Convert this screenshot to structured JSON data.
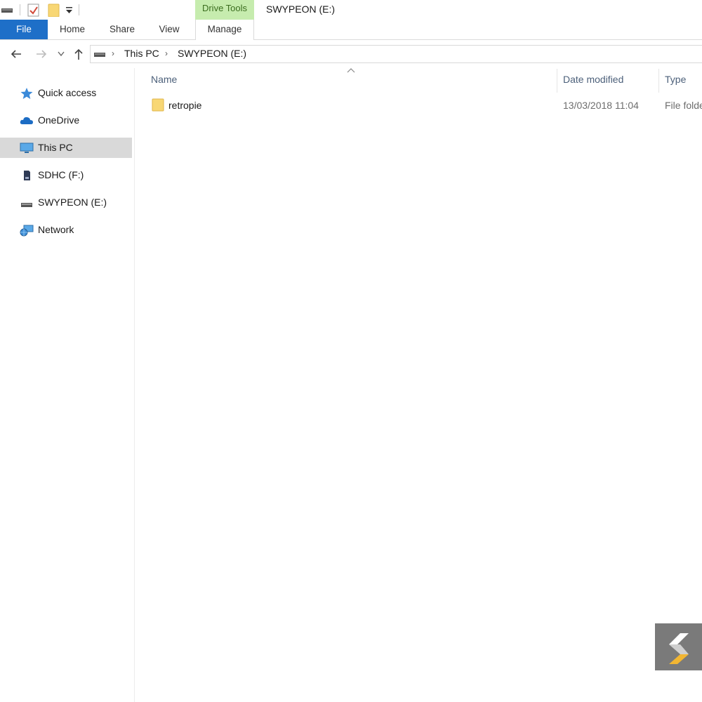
{
  "window": {
    "title": "SWYPEON (E:)"
  },
  "ribbon": {
    "context_group": "Drive Tools",
    "tabs": [
      {
        "label": "File"
      },
      {
        "label": "Home"
      },
      {
        "label": "Share"
      },
      {
        "label": "View"
      },
      {
        "label": "Manage"
      }
    ]
  },
  "address": {
    "breadcrumbs": [
      "This PC",
      "SWYPEON (E:)"
    ],
    "separator": "›"
  },
  "nav_pane": {
    "items": [
      {
        "label": "Quick access",
        "icon": "star-icon"
      },
      {
        "label": "OneDrive",
        "icon": "cloud-icon"
      },
      {
        "label": "This PC",
        "icon": "monitor-icon",
        "selected": true
      },
      {
        "label": "SDHC (F:)",
        "icon": "sd-card-icon"
      },
      {
        "label": "SWYPEON (E:)",
        "icon": "usb-drive-icon"
      },
      {
        "label": "Network",
        "icon": "network-icon"
      }
    ]
  },
  "file_list": {
    "columns": [
      "Name",
      "Date modified",
      "Type"
    ],
    "rows": [
      {
        "name": "retropie",
        "date_modified": "13/03/2018 11:04",
        "type": "File folde"
      }
    ]
  },
  "colors": {
    "file_tab": "#1e6fc8",
    "context_tab": "#c6ecae",
    "selection": "#d9d9d9",
    "header_text": "#4c607a"
  }
}
